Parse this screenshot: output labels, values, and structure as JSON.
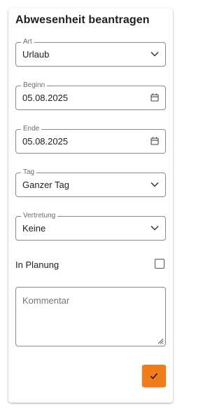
{
  "form": {
    "title": "Abwesenheit beantragen",
    "art": {
      "label": "Art",
      "value": "Urlaub"
    },
    "beginn": {
      "label": "Beginn",
      "value": "05.08.2025"
    },
    "ende": {
      "label": "Ende",
      "value": "05.08.2025"
    },
    "tag": {
      "label": "Tag",
      "value": "Ganzer Tag"
    },
    "vertretung": {
      "label": "Vertretung",
      "value": "Keine"
    },
    "in_planung": {
      "label": "In Planung",
      "checked": false
    },
    "kommentar": {
      "placeholder": "Kommentar",
      "value": ""
    },
    "submit": {
      "icon": "check-icon"
    }
  },
  "colors": {
    "accent": "#f07c1a",
    "border": "#8a8a8a",
    "text": "#212121",
    "label": "#6b6b6b"
  }
}
